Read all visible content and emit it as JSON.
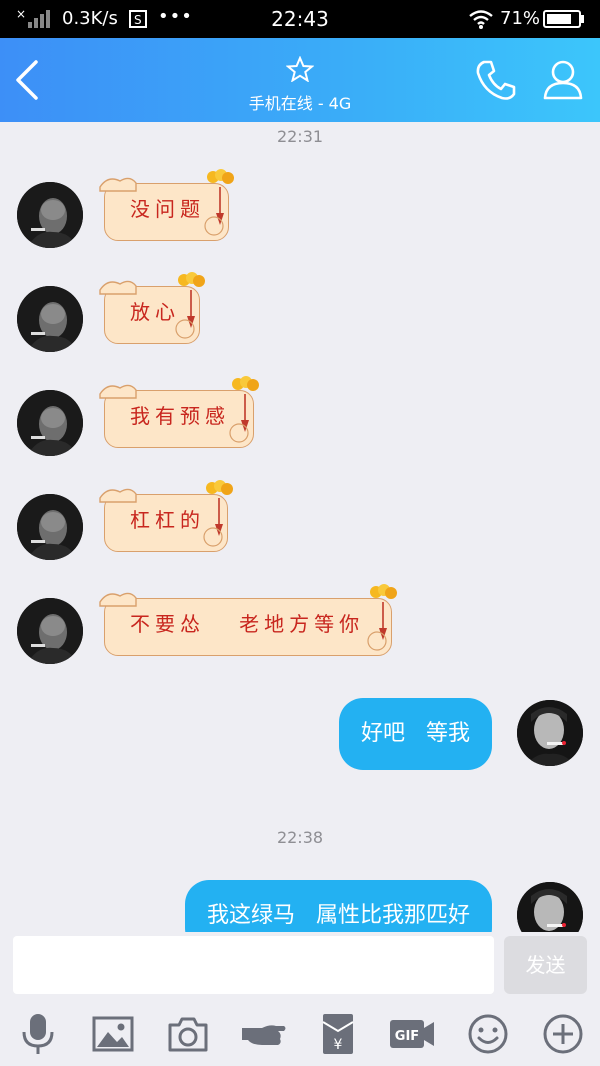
{
  "status_bar": {
    "net_speed": "0.3K/s",
    "dots": "•••",
    "time": "22:43",
    "battery": "71%"
  },
  "header": {
    "subtitle": "手机在线 - 4G",
    "icons": [
      "back-icon",
      "star-icon",
      "phone-icon",
      "profile-icon"
    ]
  },
  "chat": {
    "timestamps": [
      "22:31",
      "22:38"
    ],
    "received": [
      {
        "text": "没问题"
      },
      {
        "text": "放心"
      },
      {
        "text": "我有预感"
      },
      {
        "text": "杠杠的"
      },
      {
        "text": "不要怂   老地方等你"
      }
    ],
    "sent": [
      {
        "text": "好吧   等我"
      },
      {
        "text": "我这绿马   属性比我那匹好"
      }
    ]
  },
  "input": {
    "placeholder": "",
    "send_label": "发送"
  },
  "toolbar": {
    "icons": [
      "mic-icon",
      "image-icon",
      "camera-icon",
      "hand-icon",
      "red-packet-icon",
      "gif-icon",
      "emoji-icon",
      "plus-icon"
    ],
    "red_packet_symbol": "¥",
    "gif_label": "GIF"
  },
  "colors": {
    "header_start": "#3d8ff7",
    "header_end": "#3cc6fb",
    "sent_bubble": "#23b1f2",
    "scroll_paper": "#fde6c8",
    "scroll_text": "#c8261e"
  }
}
